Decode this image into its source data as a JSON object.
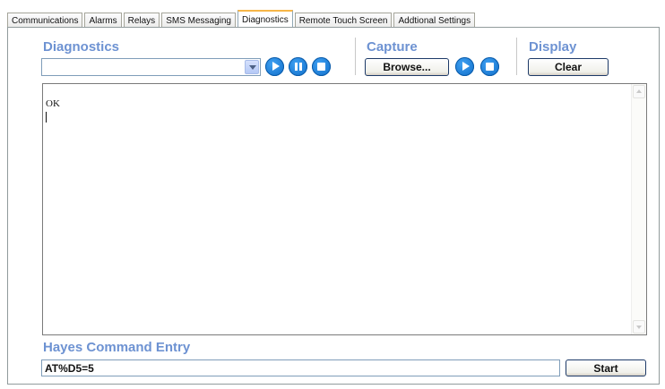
{
  "tabs": [
    "Communications",
    "Alarms",
    "Relays",
    "SMS Messaging",
    "Diagnostics",
    "Remote Touch Screen",
    "Addtional Settings"
  ],
  "active_tab": "Diagnostics",
  "diagnostics": {
    "title": "Diagnostics",
    "selected_value": ""
  },
  "capture": {
    "title": "Capture",
    "browse_label": "Browse..."
  },
  "display": {
    "title": "Display",
    "clear_label": "Clear"
  },
  "output": {
    "text": "OK"
  },
  "hayes": {
    "title": "Hayes Command Entry",
    "command_value": "AT%D5=5",
    "start_label": "Start"
  },
  "colors": {
    "section_title": "#6d92d2",
    "round_button": "#0e6cc7",
    "active_tab_accent": "#f7b648"
  },
  "icons": [
    "play-icon",
    "pause-icon",
    "stop-icon",
    "chevron-down-icon"
  ]
}
